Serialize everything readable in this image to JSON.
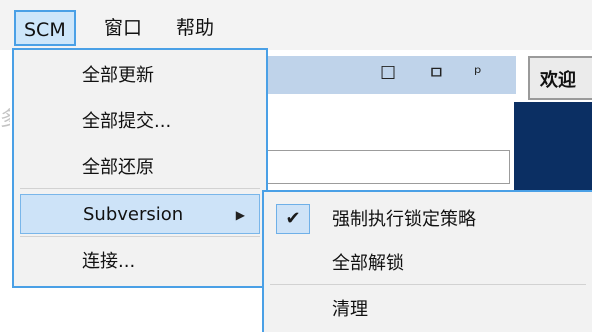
{
  "menubar": {
    "items": [
      {
        "label": "SCM",
        "active": true
      },
      {
        "label": "窗口",
        "active": false
      },
      {
        "label": "帮助",
        "active": false
      }
    ]
  },
  "background": {
    "panel_controls": {
      "restore": "☐",
      "dock": "ㅁ",
      "pin": "ᵖ"
    },
    "tab_label": "欢迎"
  },
  "scm_menu": {
    "items": [
      {
        "label": "全部更新"
      },
      {
        "label": "全部提交..."
      },
      {
        "label": "全部还原"
      },
      {
        "label": "Subversion",
        "has_submenu": true,
        "highlighted": true
      },
      {
        "label": "连接..."
      }
    ],
    "submenu_arrow": "▶"
  },
  "subversion_menu": {
    "items": [
      {
        "label": "强制执行锁定策略",
        "checked": true
      },
      {
        "label": "全部解锁"
      },
      {
        "label": "清理"
      }
    ],
    "check_glyph": "✔"
  },
  "colors": {
    "accent": "#4aa0e6",
    "highlight": "#cde3f8",
    "navy": "#0b2f63",
    "menu_bg": "#f2f2f2"
  }
}
